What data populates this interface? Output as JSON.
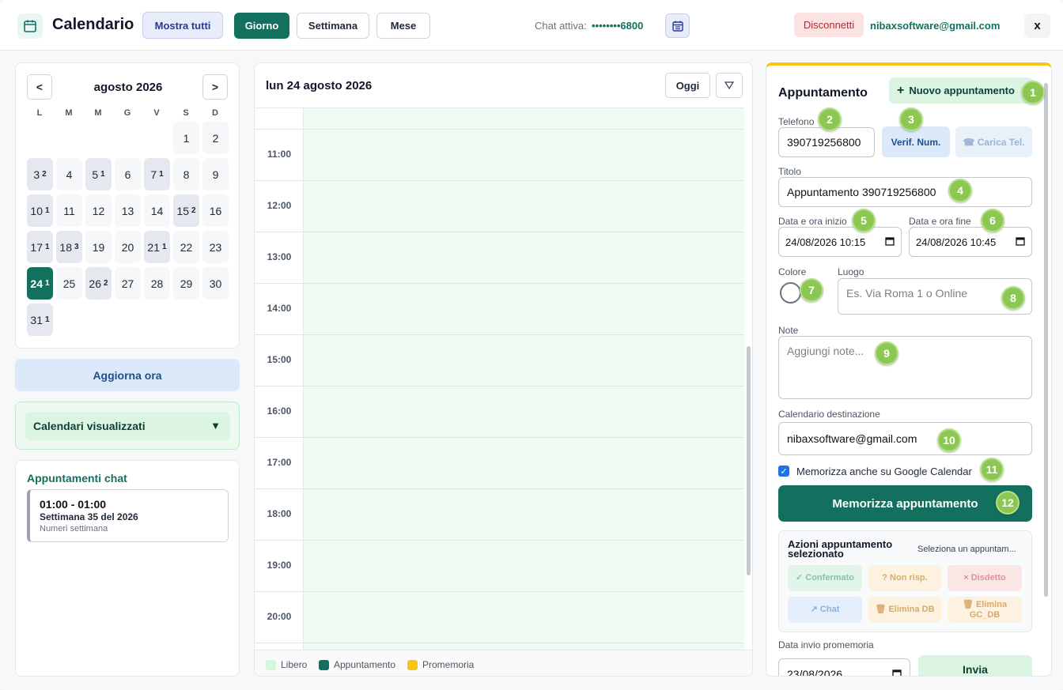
{
  "header": {
    "title": "Calendario",
    "mostra_tutti": "Mostra tutti",
    "view_tabs": [
      "Giorno",
      "Settimana",
      "Mese"
    ],
    "chat_label": "Chat attiva:",
    "chat_number": "••••••••6800",
    "disconnect": "Disconnetti",
    "email": "nibaxsoftware@gmail.com",
    "close": "x"
  },
  "mini_calendar": {
    "prev": "<",
    "next": ">",
    "month_label": "agosto 2026",
    "weekdays": [
      "L",
      "M",
      "M",
      "G",
      "V",
      "S",
      "D"
    ],
    "days": [
      {
        "d": "1",
        "c": ""
      },
      {
        "d": "2",
        "c": ""
      },
      {
        "d": "3",
        "c": "2"
      },
      {
        "d": "4",
        "c": ""
      },
      {
        "d": "5",
        "c": "1"
      },
      {
        "d": "6",
        "c": ""
      },
      {
        "d": "7",
        "c": "1"
      },
      {
        "d": "8",
        "c": ""
      },
      {
        "d": "9",
        "c": ""
      },
      {
        "d": "10",
        "c": "1"
      },
      {
        "d": "11",
        "c": ""
      },
      {
        "d": "12",
        "c": ""
      },
      {
        "d": "13",
        "c": ""
      },
      {
        "d": "14",
        "c": ""
      },
      {
        "d": "15",
        "c": "2"
      },
      {
        "d": "16",
        "c": ""
      },
      {
        "d": "17",
        "c": "1"
      },
      {
        "d": "18",
        "c": "3"
      },
      {
        "d": "19",
        "c": ""
      },
      {
        "d": "20",
        "c": ""
      },
      {
        "d": "21",
        "c": "1"
      },
      {
        "d": "22",
        "c": ""
      },
      {
        "d": "23",
        "c": ""
      },
      {
        "d": "24",
        "c": "1",
        "selected": true
      },
      {
        "d": "25",
        "c": ""
      },
      {
        "d": "26",
        "c": "2"
      },
      {
        "d": "27",
        "c": ""
      },
      {
        "d": "28",
        "c": ""
      },
      {
        "d": "29",
        "c": ""
      },
      {
        "d": "30",
        "c": ""
      },
      {
        "d": "31",
        "c": "1"
      }
    ]
  },
  "sidebar": {
    "refresh": "Aggiorna ora",
    "calendars_toggle": "Calendari visualizzati",
    "chat_appointments_title": "Appuntamenti chat",
    "chat_appointment": {
      "time": "01:00 - 01:00",
      "week": "Settimana 35 del 2026",
      "sub": "Numeri settimana"
    }
  },
  "day_view": {
    "title": "lun 24 agosto 2026",
    "today": "Oggi",
    "hours": [
      "11:00",
      "12:00",
      "13:00",
      "14:00",
      "15:00",
      "16:00",
      "17:00",
      "18:00",
      "19:00",
      "20:00"
    ],
    "legend": [
      {
        "label": "Libero",
        "color": "#d6f5dd"
      },
      {
        "label": "Appuntamento",
        "color": "#13705f"
      },
      {
        "label": "Promemoria",
        "color": "#f5c518"
      }
    ]
  },
  "form": {
    "title": "Appuntamento",
    "new_button": "Nuovo appuntamento",
    "phone_label": "Telefono",
    "phone_value": "390719256800",
    "verify": "Verif. Num.",
    "load_phone": "☎ Carica Tel.",
    "title_label": "Titolo",
    "title_value": "Appuntamento 390719256800",
    "start_label": "Data e ora inizio",
    "start_value": "24/08/2026 10:15",
    "end_label": "Data e ora fine",
    "end_value": "24/08/2026 10:45",
    "color_label": "Colore",
    "place_label": "Luogo",
    "place_placeholder": "Es. Via Roma 1 o Online",
    "notes_label": "Note",
    "notes_placeholder": "Aggiungi note...",
    "dest_label": "Calendario destinazione",
    "dest_value": "nibaxsoftware@gmail.com",
    "google_checkbox": "Memorizza anche su Google Calendar",
    "save": "Memorizza appuntamento",
    "actions_title": "Azioni appuntamento selezionato",
    "actions_hint": "Seleziona un appuntam...",
    "actions": [
      {
        "label": "✓ Confermato",
        "bg": "#e3f5ea",
        "fg": "#86c3a0"
      },
      {
        "label": "? Non risp.",
        "bg": "#fdf2e0",
        "fg": "#d9aa6a"
      },
      {
        "label": "× Disdetto",
        "bg": "#fbe5e5",
        "fg": "#e09595"
      },
      {
        "label": "↗ Chat",
        "bg": "#e5eefb",
        "fg": "#8fb0dc"
      },
      {
        "label": "🗑 Elimina DB",
        "bg": "#fdf2e0",
        "fg": "#d9aa6a"
      },
      {
        "label": "🗑 Elimina GC_DB",
        "bg": "#fdf2e0",
        "fg": "#d9aa6a"
      }
    ],
    "reminder_label": "Data invio promemoria",
    "reminder_value": "23/08/2026",
    "send": "Invia"
  },
  "markers": [
    "1",
    "2",
    "3",
    "4",
    "5",
    "6",
    "7",
    "8",
    "9",
    "10",
    "11",
    "12"
  ]
}
